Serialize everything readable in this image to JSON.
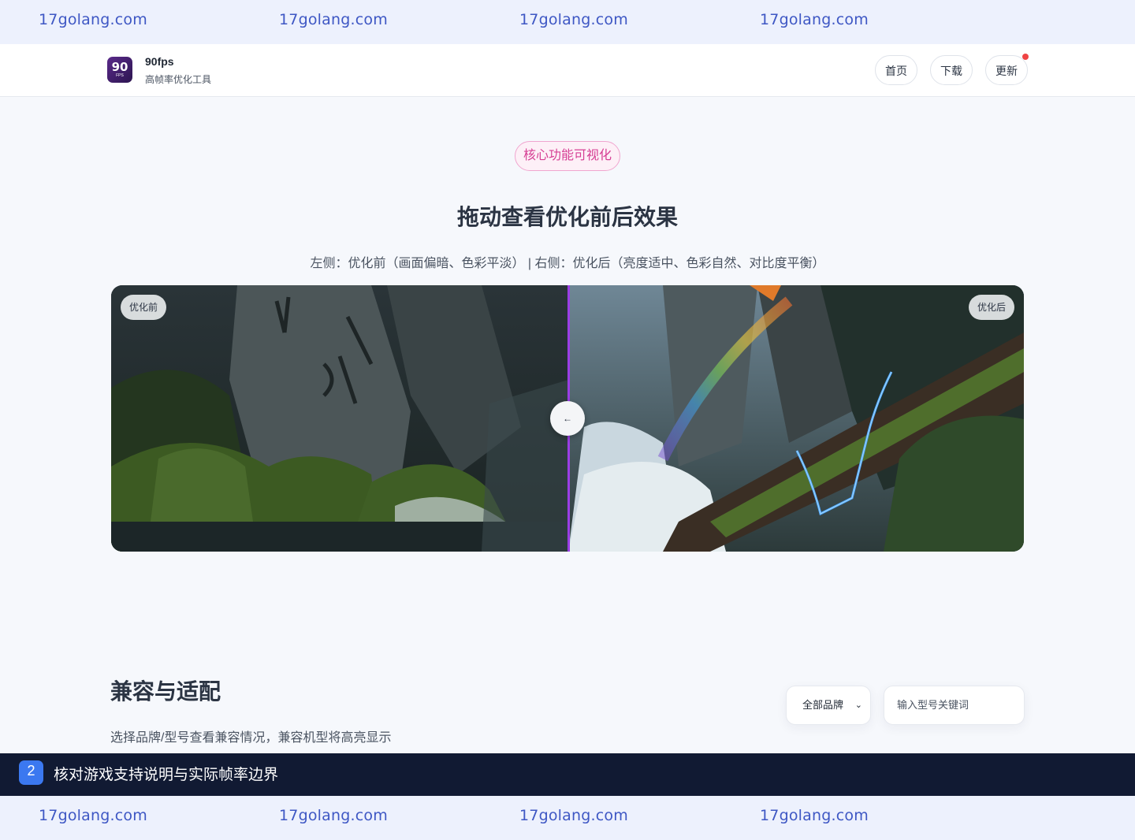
{
  "watermark": {
    "text_1": "17golang.com",
    "text_2": "17golang.com",
    "text_3": "17golang.com",
    "text_4": "17golang.com",
    "text_5": "17golang.com",
    "text_6": "17golang.com",
    "text_7": "17golang.com",
    "text_8": "17golang.com"
  },
  "header": {
    "logo_big": "90",
    "logo_small": "FPS",
    "app_name": "90fps",
    "app_subtitle": "高帧率优化工具",
    "nav": {
      "home": "首页",
      "download": "下载",
      "update": "更新"
    },
    "update_badge_color": "#ef4444"
  },
  "feature": {
    "badge": "核心功能可视化",
    "title": "拖动查看优化前后效果",
    "description": "左侧：优化前（画面偏暗、色彩平淡） | 右侧：优化后（亮度适中、色彩自然、对比度平衡）",
    "before_label": "优化前",
    "after_label": "优化后",
    "handle_icon": "arrow-left-icon",
    "handle_glyph": "←",
    "divider_color": "#9b3ee6"
  },
  "compat": {
    "title": "兼容与适配",
    "description": "选择品牌/型号查看兼容情况，兼容机型将高亮显示",
    "brand_select": "全部品牌",
    "search_placeholder": "输入型号关键词"
  },
  "bottom_bar": {
    "step": "2",
    "text": "核对游戏支持说明与实际帧率边界"
  }
}
